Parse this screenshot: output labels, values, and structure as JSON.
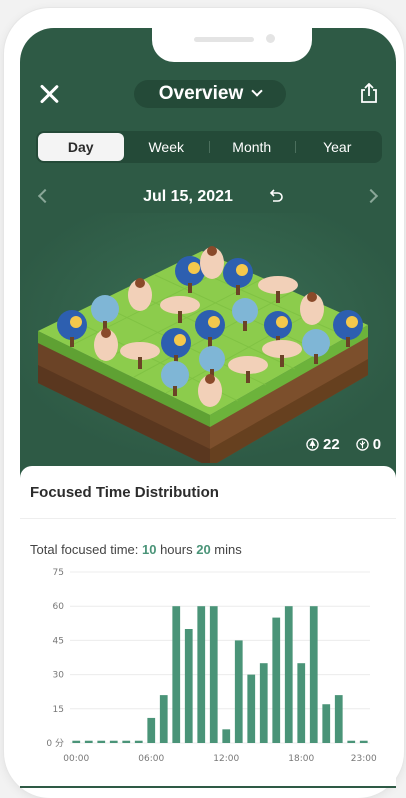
{
  "header": {
    "title": "Overview"
  },
  "tabs": [
    {
      "label": "Day",
      "active": true
    },
    {
      "label": "Week",
      "active": false
    },
    {
      "label": "Month",
      "active": false
    },
    {
      "label": "Year",
      "active": false
    }
  ],
  "date": {
    "label": "Jul 15, 2021"
  },
  "counts": {
    "healthy_trees": "22",
    "dead_trees": "0"
  },
  "card": {
    "title": "Focused Time Distribution",
    "total_prefix": "Total focused time: ",
    "total_hours": "10",
    "hours_word": " hours ",
    "total_mins": "20",
    "mins_word": " mins"
  },
  "colors": {
    "screen_bg": "#2e5a45",
    "bar": "#4a9478",
    "accent": "#4a9478"
  },
  "chart_data": {
    "type": "bar",
    "title": "Focused Time Distribution",
    "xlabel": "",
    "ylabel": "",
    "ylim": [
      0,
      75
    ],
    "y_ticks": [
      "0 分",
      "15",
      "30",
      "45",
      "60",
      "75"
    ],
    "x_ticks": [
      "00:00",
      "06:00",
      "12:00",
      "18:00",
      "23:00"
    ],
    "categories": [
      "00",
      "01",
      "02",
      "03",
      "04",
      "05",
      "06",
      "07",
      "08",
      "09",
      "10",
      "11",
      "12",
      "13",
      "14",
      "15",
      "16",
      "17",
      "18",
      "19",
      "20",
      "21",
      "22",
      "23"
    ],
    "values": [
      1,
      1,
      1,
      1,
      1,
      1,
      11,
      21,
      60,
      50,
      60,
      60,
      6,
      45,
      30,
      35,
      55,
      60,
      35,
      60,
      17,
      21,
      1,
      1
    ],
    "grid": true
  }
}
